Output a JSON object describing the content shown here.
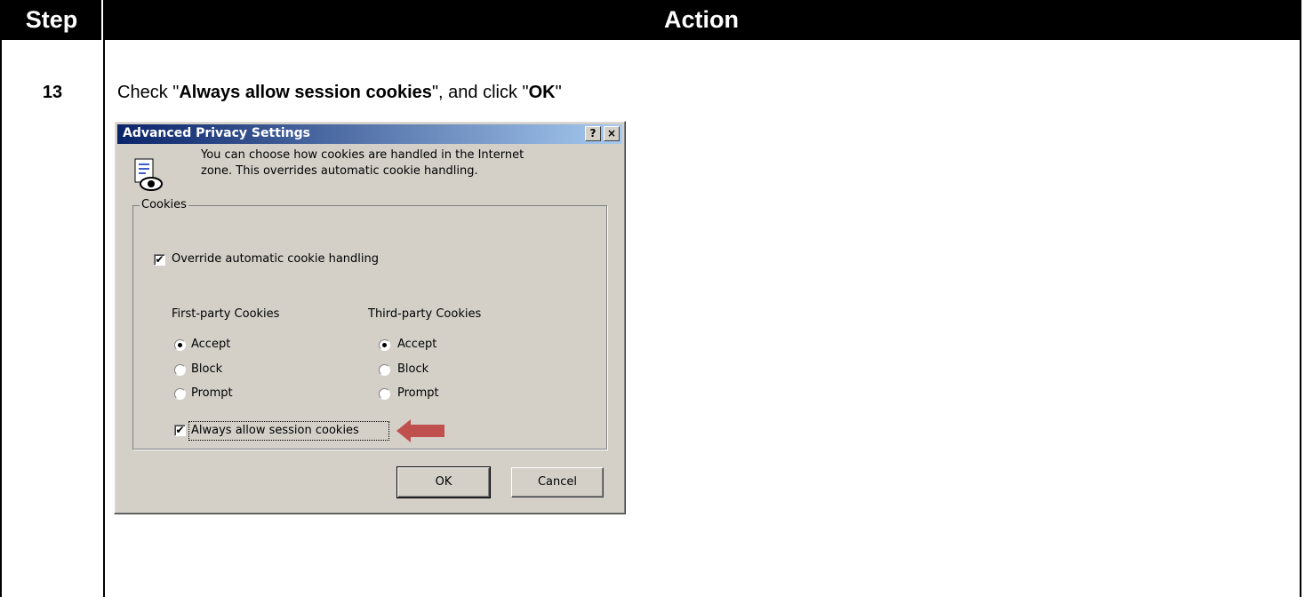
{
  "header": {
    "step": "Step",
    "action": "Action"
  },
  "row": {
    "step_number": "13",
    "instruction_prefix": "Check \"",
    "instruction_bold1": "Always allow session cookies",
    "instruction_middle": "\", and click \"",
    "instruction_bold2": "OK",
    "instruction_suffix": "\""
  },
  "dialog": {
    "title": "Advanced Privacy Settings",
    "help_button": "?",
    "close_button": "×",
    "info_line1": "You can choose how cookies are handled in the Internet",
    "info_line2": "zone.  This overrides automatic cookie handling.",
    "group_label": "Cookies",
    "override_label": "Override automatic cookie handling",
    "override_checked": true,
    "first_party": {
      "heading": "First-party Cookies",
      "options": [
        "Accept",
        "Block",
        "Prompt"
      ],
      "selected": "Accept"
    },
    "third_party": {
      "heading": "Third-party Cookies",
      "options": [
        "Accept",
        "Block",
        "Prompt"
      ],
      "selected": "Accept"
    },
    "session_label": "Always allow session cookies",
    "session_checked": true,
    "ok_label": "OK",
    "cancel_label": "Cancel"
  },
  "colors": {
    "arrow": "#c0504d",
    "titlebar_start": "#0a246a",
    "titlebar_end": "#a6caf0",
    "dialog_bg": "#d4d0c8"
  }
}
